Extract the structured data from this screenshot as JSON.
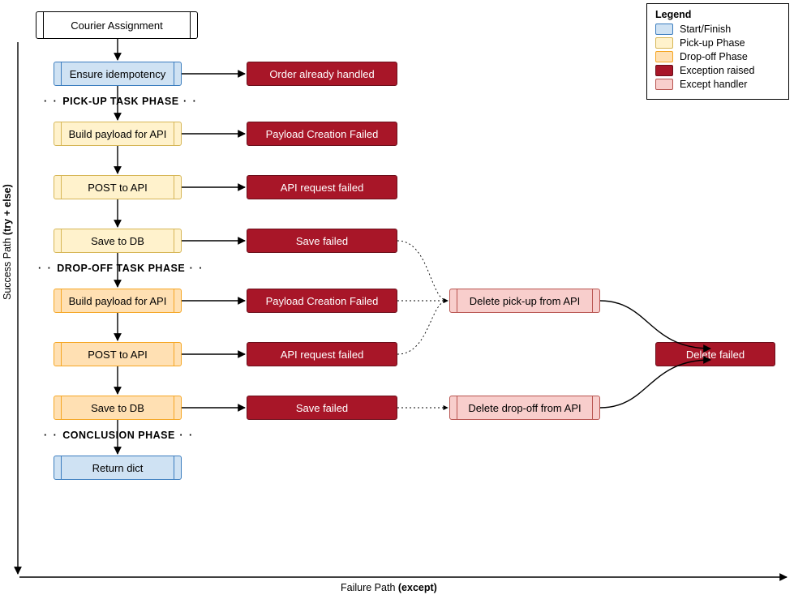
{
  "legend": {
    "title": "Legend",
    "items": [
      {
        "label": "Start/Finish",
        "class": "sw-blue"
      },
      {
        "label": "Pick-up Phase",
        "class": "sw-yellow"
      },
      {
        "label": "Drop-off Phase",
        "class": "sw-orange"
      },
      {
        "label": "Exception raised",
        "class": "sw-darkred"
      },
      {
        "label": "Except handler",
        "class": "sw-pink"
      }
    ]
  },
  "axis": {
    "vertical_prefix": "Success Path ",
    "vertical_bold": "(try + else)",
    "horizontal_prefix": "Failure Path ",
    "horizontal_bold": "(except)"
  },
  "phase_labels": {
    "pickup": "PICK-UP TASK PHASE",
    "dropoff": "DROP-OFF TASK PHASE",
    "conclusion": "CONCLUSION PHASE"
  },
  "nodes": {
    "n_start": "Courier Assignment",
    "n_idem": "Ensure idempotency",
    "n_p_build": "Build payload for API",
    "n_p_post": "POST to API",
    "n_p_save": "Save to DB",
    "n_d_build": "Build payload for API",
    "n_d_post": "POST to API",
    "n_d_save": "Save to DB",
    "n_return": "Return dict",
    "err_idem": "Order already handled",
    "err_p_build": "Payload Creation Failed",
    "err_p_post": "API request failed",
    "err_p_save": "Save failed",
    "err_d_build": "Payload Creation Failed",
    "err_d_post": "API request failed",
    "err_d_save": "Save failed",
    "hnd_pickup": "Delete pick-up from API",
    "hnd_dropoff": "Delete drop-off from API",
    "err_delete": "Delete failed"
  }
}
